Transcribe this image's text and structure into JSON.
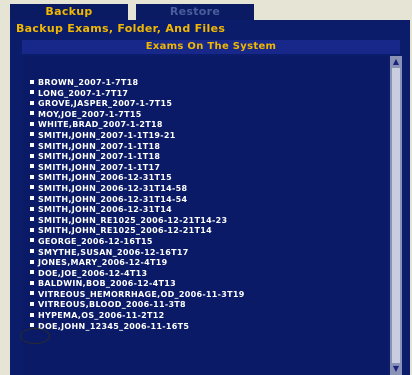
{
  "tabs": {
    "backup": "Backup",
    "restore": "Restore"
  },
  "section_title": "Backup Exams, Folder, And Files",
  "list_header": "Exams On The System",
  "exams": [
    "BROWN_2007-1-7T18",
    "LONG_2007-1-7T17",
    "GROVE,JASPER_2007-1-7T15",
    "MOY,JOE_2007-1-7T15",
    "WHITE,BRAD_2007-1-2T18",
    "SMITH,JOHN_2007-1-1T19-21",
    "SMITH,JOHN_2007-1-1T18",
    "SMITH,JOHN_2007-1-1T18",
    "SMITH,JOHN_2007-1-1T17",
    "SMITH,JOHN_2006-12-31T15",
    "SMITH,JOHN_2006-12-31T14-58",
    "SMITH,JOHN_2006-12-31T14-54",
    "SMITH,JOHN_2006-12-31T14",
    "SMITH,JOHN_RE1025_2006-12-21T14-23",
    "SMITH,JOHN_RE1025_2006-12-21T14",
    "GEORGE_2006-12-16T15",
    "SMYTHE,SUSAN_2006-12-16T17",
    "JONES,MARY_2006-12-4T19",
    "DOE,JOE_2006-12-4T13",
    "BALDWIN,BOB_2006-12-4T13",
    "VITREOUS_HEMORRHAGE,OD_2006-11-3T19",
    "VITREOUS,BLOOD_2006-11-3T8",
    "HYPEMA,OS_2006-11-2T12",
    "DOE,JOHN_12345_2006-11-16T5"
  ],
  "colors": {
    "panel": "#0b1d6a",
    "accent": "#f2b800",
    "text": "#ffffff"
  }
}
